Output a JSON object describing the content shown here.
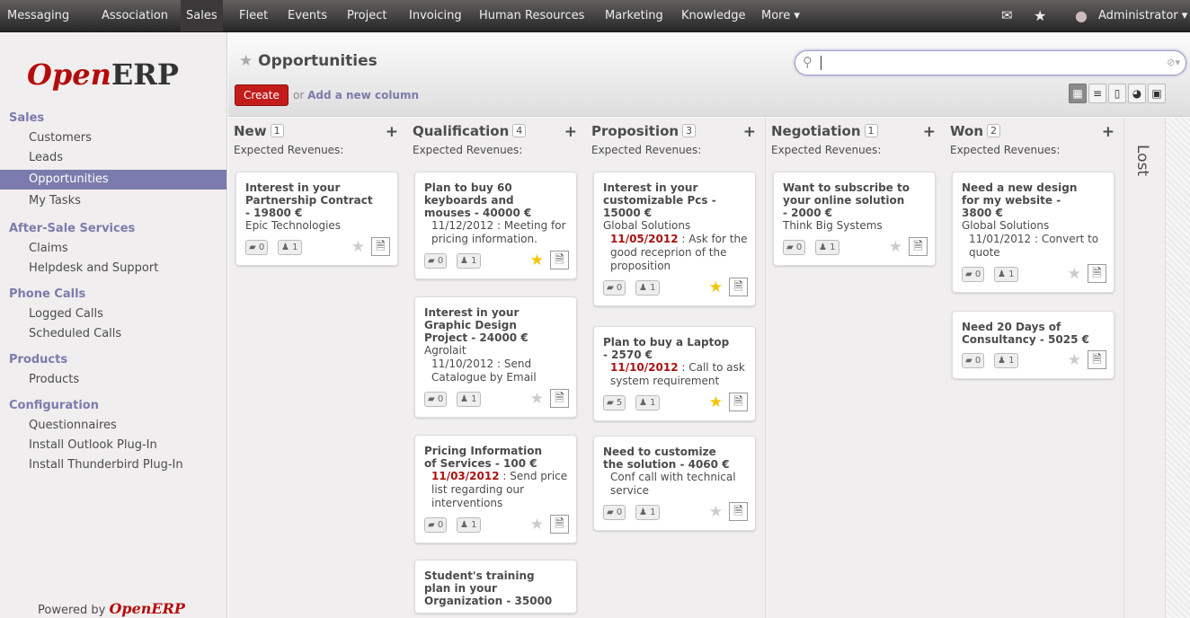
{
  "topbar": {
    "items": [
      "Messaging",
      "Association",
      "Sales",
      "Fleet",
      "Events",
      "Project",
      "Invoicing",
      "Human Resources",
      "Marketing",
      "Knowledge",
      "More ▾"
    ],
    "user": "Administrator ▾"
  },
  "logo": {
    "open": "Open",
    "erp": "ERP"
  },
  "sidebar": {
    "sections": [
      {
        "title": "Sales",
        "items": [
          "Customers",
          "Leads",
          "Opportunities",
          "My Tasks"
        ]
      },
      {
        "title": "After-Sale Services",
        "items": [
          "Claims",
          "Helpdesk and Support"
        ]
      },
      {
        "title": "Phone Calls",
        "items": [
          "Logged Calls",
          "Scheduled Calls"
        ]
      },
      {
        "title": "Products",
        "items": [
          "Products"
        ]
      },
      {
        "title": "Configuration",
        "items": [
          "Questionnaires",
          "Install Outlook Plug-In",
          "Install Thunderbird Plug-In"
        ]
      }
    ],
    "selected": "Opportunities",
    "powered_prefix": "Powered by ",
    "powered_brand": "OpenERP"
  },
  "header": {
    "title": "Opportunities",
    "create": "Create",
    "or": "or ",
    "add_column": "Add a new column"
  },
  "columns": [
    {
      "name": "New",
      "count": "1",
      "revenue": "Expected Revenues:",
      "cards": [
        {
          "title": [
            "Interest in your",
            "Partnership Contract",
            "- 19800 €"
          ],
          "lines": [
            {
              "text": "Epic Technologies"
            }
          ],
          "msgs": "0",
          "users": "1",
          "star": false
        }
      ]
    },
    {
      "name": "Qualification",
      "count": "4",
      "revenue": "Expected Revenues:",
      "cards": [
        {
          "title": [
            "Plan to buy 60",
            "keyboards and",
            "mouses - 40000 €"
          ],
          "lines": [
            {
              "text": "11/12/2012 : Meeting for",
              "ind": true
            },
            {
              "text": "pricing information.",
              "ind": true
            }
          ],
          "msgs": "0",
          "users": "1",
          "star": true
        },
        {
          "title": [
            "Interest in your",
            "Graphic Design",
            "Project - 24000 €"
          ],
          "lines": [
            {
              "text": "Agrolait"
            },
            {
              "text": "11/10/2012 : Send",
              "ind": true
            },
            {
              "text": "Catalogue by Email",
              "ind": true
            }
          ],
          "msgs": "0",
          "users": "1",
          "star": false
        },
        {
          "title": [
            "Pricing Information",
            "of Services - 100 €"
          ],
          "lines": [
            {
              "date": "11/03/2012",
              "text": " : Send price",
              "ind": true
            },
            {
              "text": "list regarding our",
              "ind": true
            },
            {
              "text": "interventions",
              "ind": true
            }
          ],
          "msgs": "0",
          "users": "1",
          "star": false
        },
        {
          "title": [
            "Student's training",
            "plan in your",
            "Organization - 35000"
          ],
          "lines": [],
          "msgs": "",
          "users": "",
          "star": false
        }
      ]
    },
    {
      "name": "Proposition",
      "count": "3",
      "revenue": "Expected Revenues:",
      "cards": [
        {
          "title": [
            "Interest in your",
            "customizable Pcs -",
            "15000 €"
          ],
          "lines": [
            {
              "text": "Global Solutions"
            },
            {
              "date": "11/05/2012",
              "text": " : Ask for the",
              "ind": true
            },
            {
              "text": "good receprion of the",
              "ind": true
            },
            {
              "text": "proposition",
              "ind": true
            }
          ],
          "msgs": "0",
          "users": "1",
          "star": true
        },
        {
          "title": [
            "Plan to buy a Laptop",
            "- 2570 €"
          ],
          "lines": [
            {
              "date": "11/10/2012",
              "text": " : Call to ask",
              "ind": true
            },
            {
              "text": "system requirement",
              "ind": true
            }
          ],
          "msgs": "5",
          "users": "1",
          "star": true
        },
        {
          "title": [
            "Need to customize",
            "the solution - 4060 €"
          ],
          "lines": [
            {
              "text": "Conf call with technical",
              "ind": true
            },
            {
              "text": "service",
              "ind": true
            }
          ],
          "msgs": "0",
          "users": "1",
          "star": false
        }
      ]
    },
    {
      "name": "Negotiation",
      "count": "1",
      "revenue": "Expected Revenues:",
      "cards": [
        {
          "title": [
            "Want to subscribe to",
            "your online solution",
            "- 2000 €"
          ],
          "lines": [
            {
              "text": "Think Big Systems"
            }
          ],
          "msgs": "0",
          "users": "1",
          "star": false
        }
      ]
    },
    {
      "name": "Won",
      "count": "2",
      "revenue": "Expected Revenues:",
      "cards": [
        {
          "title": [
            "Need a new design",
            "for my website -",
            "3800 €"
          ],
          "lines": [
            {
              "text": "Global Solutions"
            },
            {
              "text": "11/01/2012 : Convert to",
              "ind": true
            },
            {
              "text": "quote",
              "ind": true
            }
          ],
          "msgs": "0",
          "users": "1",
          "star": false
        },
        {
          "title": [
            "Need 20 Days of",
            "Consultancy - 5025 €"
          ],
          "lines": [],
          "msgs": "0",
          "users": "1",
          "star": false
        }
      ]
    }
  ],
  "lost": "Lost",
  "colors": {
    "accent": "#7c7bad",
    "create": "#c41b1b",
    "date": "#aa1111",
    "star_on": "#f5c400"
  }
}
